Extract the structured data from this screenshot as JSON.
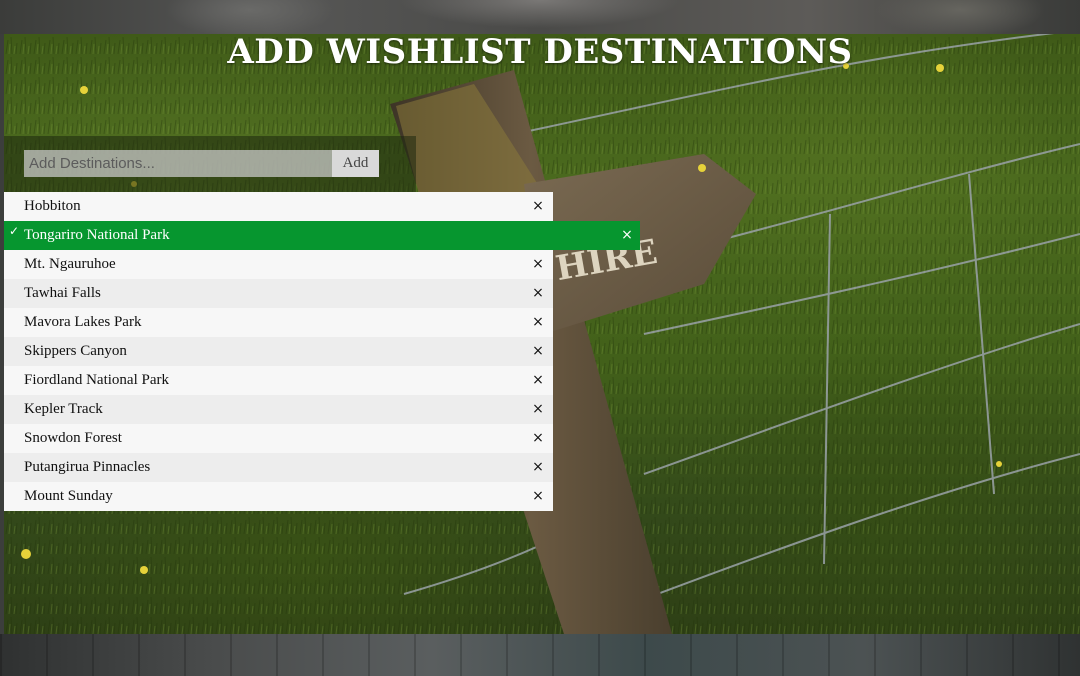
{
  "page": {
    "title": "ADD WISHLIST DESTINATIONS"
  },
  "form": {
    "input_placeholder": "Add Destinations...",
    "input_value": "",
    "add_label": "Add"
  },
  "destinations": [
    {
      "label": "Hobbiton",
      "checked": false
    },
    {
      "label": "Tongariro National Park",
      "checked": true
    },
    {
      "label": "Mt. Ngauruhoe",
      "checked": false
    },
    {
      "label": "Tawhai Falls",
      "checked": false
    },
    {
      "label": "Mavora Lakes Park",
      "checked": false
    },
    {
      "label": "Skippers Canyon",
      "checked": false
    },
    {
      "label": "Fiordland National Park",
      "checked": false
    },
    {
      "label": "Kepler Track",
      "checked": false
    },
    {
      "label": "Snowdon Forest",
      "checked": false
    },
    {
      "label": "Putangirua Pinnacles",
      "checked": false
    },
    {
      "label": "Mount Sunday",
      "checked": false
    }
  ],
  "icons": {
    "check": "✓",
    "close": "×"
  },
  "colors": {
    "checked_bg": "#06962f",
    "row_odd": "#f7f7f7",
    "row_even": "#ededed"
  },
  "sign_text": "HIRE"
}
